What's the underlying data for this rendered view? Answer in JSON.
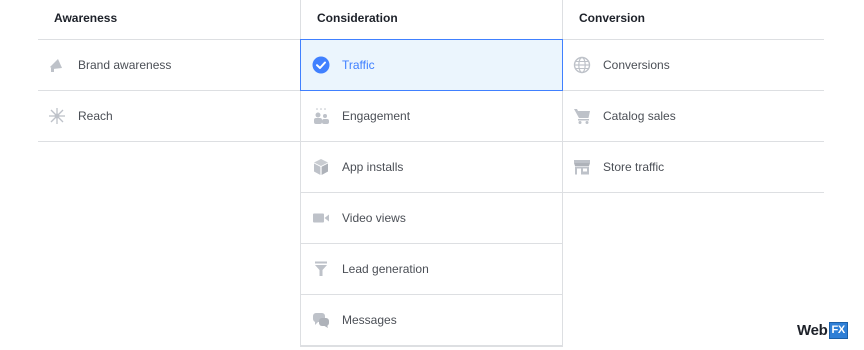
{
  "columns": [
    {
      "title": "Awareness",
      "items": [
        {
          "label": "Brand awareness",
          "icon": "megaphone-icon"
        },
        {
          "label": "Reach",
          "icon": "reach-icon"
        }
      ]
    },
    {
      "title": "Consideration",
      "items": [
        {
          "label": "Traffic",
          "icon": "check-circle-icon",
          "selected": true
        },
        {
          "label": "Engagement",
          "icon": "people-icon"
        },
        {
          "label": "App installs",
          "icon": "box-icon"
        },
        {
          "label": "Video views",
          "icon": "video-camera-icon"
        },
        {
          "label": "Lead generation",
          "icon": "funnel-icon"
        },
        {
          "label": "Messages",
          "icon": "chat-bubbles-icon"
        }
      ]
    },
    {
      "title": "Conversion",
      "items": [
        {
          "label": "Conversions",
          "icon": "globe-icon"
        },
        {
          "label": "Catalog sales",
          "icon": "cart-icon"
        },
        {
          "label": "Store traffic",
          "icon": "store-icon"
        }
      ]
    }
  ],
  "logo": {
    "text": "Web",
    "badge": "FX"
  },
  "colors": {
    "accent": "#4080ff",
    "selected_bg": "#ebf5fd",
    "icon_gray": "#bec2c9",
    "border": "#dddfe2"
  }
}
